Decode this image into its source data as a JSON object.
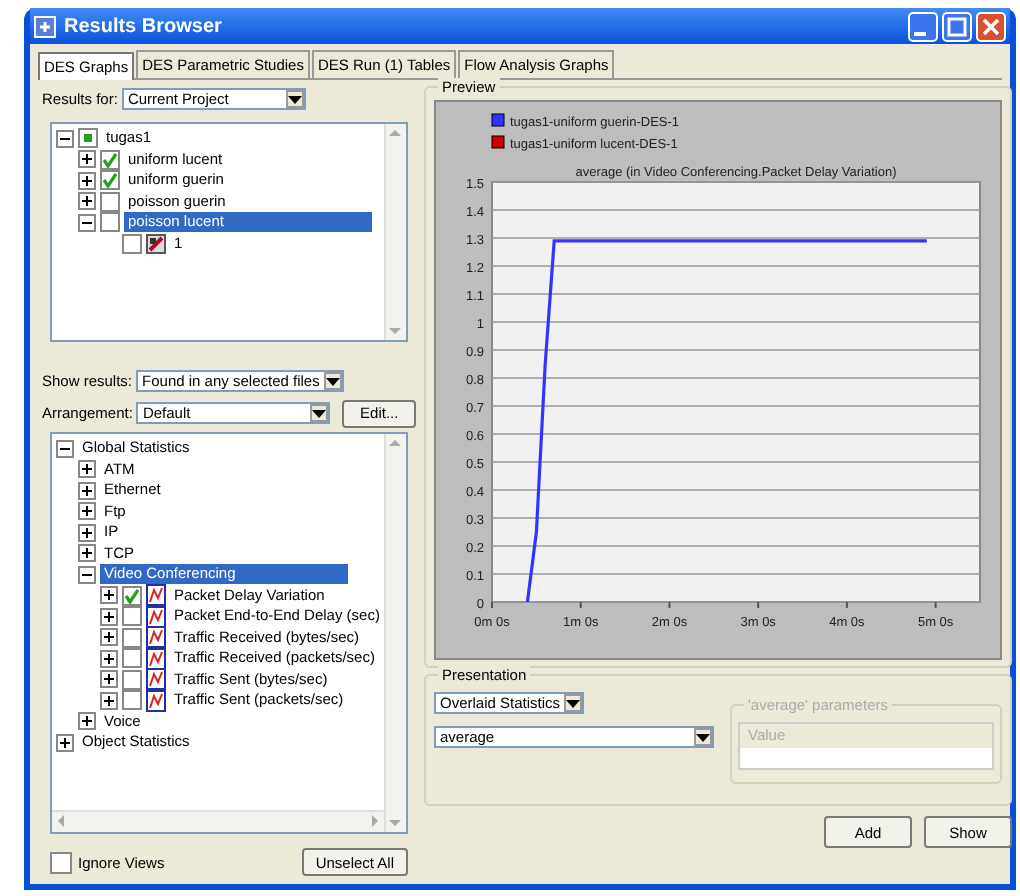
{
  "window": {
    "title": "Results Browser"
  },
  "tabs": [
    {
      "label": "DES Graphs",
      "selected": true
    },
    {
      "label": "DES Parametric Studies",
      "selected": false
    },
    {
      "label": "DES Run (1) Tables",
      "selected": false
    },
    {
      "label": "Flow Analysis Graphs",
      "selected": false
    }
  ],
  "results_for": {
    "label": "Results for:",
    "value": "Current Project"
  },
  "files_tree": [
    {
      "label": "tugas1",
      "kind": "project",
      "checked": true,
      "selected": false,
      "expanded": true,
      "children": [
        {
          "label": "uniform lucent",
          "checked": true,
          "selected": false,
          "expanded": false
        },
        {
          "label": "uniform guerin",
          "checked": true,
          "selected": false,
          "expanded": false
        },
        {
          "label": "poisson guerin",
          "checked": false,
          "selected": false,
          "expanded": false
        },
        {
          "label": "poisson lucent",
          "checked": false,
          "selected": true,
          "expanded": true,
          "children": [
            {
              "label": "1",
              "kind": "run",
              "checked": false,
              "selected": false
            }
          ]
        }
      ]
    }
  ],
  "show_results": {
    "label": "Show results:",
    "value": "Found in any selected files"
  },
  "arrangement": {
    "label": "Arrangement:",
    "value": "Default",
    "button": "Edit..."
  },
  "stats_tree": [
    {
      "label": "Global Statistics",
      "selected": false,
      "expanded": true,
      "children": [
        {
          "label": "ATM",
          "selected": false,
          "expanded": false
        },
        {
          "label": "Ethernet",
          "selected": false,
          "expanded": false
        },
        {
          "label": "Ftp",
          "selected": false,
          "expanded": false
        },
        {
          "label": "IP",
          "selected": false,
          "expanded": false
        },
        {
          "label": "TCP",
          "selected": false,
          "expanded": false
        },
        {
          "label": "Video Conferencing",
          "selected": true,
          "expanded": true,
          "children": [
            {
              "label": "Packet Delay Variation",
              "kind": "statistic",
              "checked": true,
              "selected": false,
              "expanded": false
            },
            {
              "label": "Packet End-to-End Delay (sec)",
              "kind": "statistic",
              "checked": false,
              "selected": false,
              "expanded": false
            },
            {
              "label": "Traffic Received (bytes/sec)",
              "kind": "statistic",
              "checked": false,
              "selected": false,
              "expanded": false
            },
            {
              "label": "Traffic Received (packets/sec)",
              "kind": "statistic",
              "checked": false,
              "selected": false,
              "expanded": false
            },
            {
              "label": "Traffic Sent (bytes/sec)",
              "kind": "statistic",
              "checked": false,
              "selected": false,
              "expanded": false
            },
            {
              "label": "Traffic Sent (packets/sec)",
              "kind": "statistic",
              "checked": false,
              "selected": false,
              "expanded": false
            }
          ]
        },
        {
          "label": "Voice",
          "selected": false,
          "expanded": false
        }
      ]
    },
    {
      "label": "Object Statistics",
      "selected": false,
      "expanded": false
    }
  ],
  "ignore_views": {
    "label": "Ignore Views",
    "checked": false
  },
  "unselect_all": "Unselect All",
  "preview": {
    "title": "Preview",
    "chart_data": {
      "type": "line",
      "title": "average (in Video Conferencing.Packet Delay Variation)",
      "categories": [
        "0m 0s",
        null,
        null,
        null,
        null,
        null,
        null,
        null,
        null,
        null,
        "1m 0s",
        null,
        null,
        null,
        null,
        null,
        null,
        null,
        null,
        null,
        "2m 0s",
        null,
        null,
        null,
        null,
        null,
        null,
        null,
        null,
        null,
        "3m 0s",
        null,
        null,
        null,
        null,
        null,
        null,
        null,
        null,
        null,
        "4m 0s",
        null,
        null,
        null,
        null,
        null,
        null,
        null,
        null,
        null,
        "5m 0s",
        null,
        null,
        null,
        null,
        null
      ],
      "series": [
        {
          "name": "tugas1-uniform guerin-DES-1",
          "color": "#3333ff",
          "values": [
            null,
            null,
            null,
            null,
            0,
            0.25,
            0.85,
            1.29,
            1.29,
            1.29,
            1.29,
            1.29,
            1.29,
            1.29,
            1.29,
            1.29,
            1.29,
            1.29,
            1.29,
            1.29,
            1.29,
            1.29,
            1.29,
            1.29,
            1.29,
            1.29,
            1.29,
            1.29,
            1.29,
            1.29,
            1.29,
            1.29,
            1.29,
            1.29,
            1.29,
            1.29,
            1.29,
            1.29,
            1.29,
            1.29,
            1.29,
            1.29,
            1.29,
            1.29,
            1.29,
            1.29,
            1.29,
            1.29,
            1.29,
            1.29,
            null,
            null,
            null,
            null,
            null,
            null
          ]
        },
        {
          "name": "tugas1-uniform lucent-DES-1",
          "color": "#cc0000",
          "values": [
            null,
            null,
            null,
            null,
            null,
            null,
            null,
            null,
            null,
            null,
            null,
            null,
            null,
            null,
            null,
            null,
            null,
            null,
            null,
            null,
            null,
            null,
            null,
            null,
            null,
            null,
            null,
            null,
            null,
            null,
            null,
            null,
            null,
            null,
            null,
            null,
            null,
            null,
            null,
            null,
            null,
            null,
            null,
            null,
            null,
            null,
            null,
            null,
            null,
            null,
            null,
            null,
            null,
            null,
            null,
            null
          ]
        }
      ],
      "ylim": [
        0,
        1.5
      ],
      "grid": true,
      "yticks": [
        0,
        0.1,
        0.2,
        0.3,
        0.4,
        0.5,
        0.6,
        0.7,
        0.8,
        0.9,
        1,
        1.1,
        1.2,
        1.3,
        1.4,
        1.5
      ]
    }
  },
  "presentation": {
    "title": "Presentation",
    "mode": "Overlaid Statistics",
    "filter": "average",
    "params_title": "'average' parameters",
    "params_column": "Value"
  },
  "buttons": [
    {
      "label": "Add"
    },
    {
      "label": "Show"
    }
  ]
}
